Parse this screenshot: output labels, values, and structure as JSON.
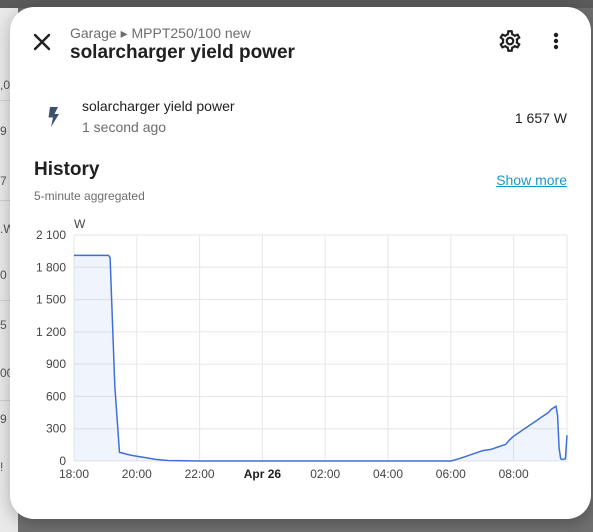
{
  "background": {
    "fragments": [
      ",0",
      "9",
      "7",
      ".W",
      "0",
      "5",
      "00",
      "9 !",
      "!"
    ]
  },
  "dialog": {
    "breadcrumb": "Garage ▸ MPPT250/100 new",
    "title": "solarcharger yield power",
    "close_icon": "close-icon",
    "settings_icon": "gear-icon",
    "more_icon": "dots-vertical-icon"
  },
  "entity": {
    "icon": "lightning-bolt-icon",
    "name": "solarcharger yield power",
    "last_changed": "1 second ago",
    "value": "1 657 W"
  },
  "history": {
    "title": "History",
    "subtitle": "5-minute aggregated",
    "show_more": "Show more"
  },
  "colors": {
    "line": "#3f6fd8",
    "link": "#1b97c7",
    "grid": "#e6e6e6"
  },
  "chart_data": {
    "type": "line",
    "ylabel": "W",
    "ylim": [
      0,
      2100
    ],
    "yticks": [
      0,
      300,
      600,
      900,
      1200,
      1500,
      1800,
      2100
    ],
    "ytick_labels": [
      "0",
      "300",
      "600",
      "900",
      "1 200",
      "1 500",
      "1 800",
      "2 100"
    ],
    "xlim": [
      18.0,
      33.7
    ],
    "xticks": [
      18,
      20,
      22,
      24,
      26,
      28,
      30,
      32
    ],
    "xtick_labels": [
      "18:00",
      "20:00",
      "22:00",
      "Apr 26",
      "02:00",
      "04:00",
      "06:00",
      "08:00"
    ],
    "grid": true,
    "series": [
      {
        "x": [
          18.0,
          19.1,
          19.15,
          19.3,
          19.45,
          19.6,
          19.8,
          20.0,
          20.3,
          20.6,
          21.0,
          22.0,
          24.0,
          26.0,
          28.0,
          30.0,
          30.25,
          30.5,
          30.8,
          31.0,
          31.3,
          31.5,
          31.75,
          31.85,
          32.0,
          32.3,
          32.5,
          32.7,
          32.9,
          33.1,
          33.2,
          33.3,
          33.35,
          33.4,
          33.45,
          33.5,
          33.55,
          33.65,
          33.7
        ],
        "y": [
          1910,
          1910,
          1890,
          700,
          80,
          70,
          55,
          45,
          30,
          15,
          5,
          0,
          0,
          0,
          0,
          0,
          20,
          45,
          75,
          95,
          110,
          130,
          155,
          190,
          230,
          290,
          330,
          370,
          410,
          450,
          480,
          500,
          510,
          420,
          120,
          20,
          15,
          20,
          240
        ]
      }
    ]
  }
}
